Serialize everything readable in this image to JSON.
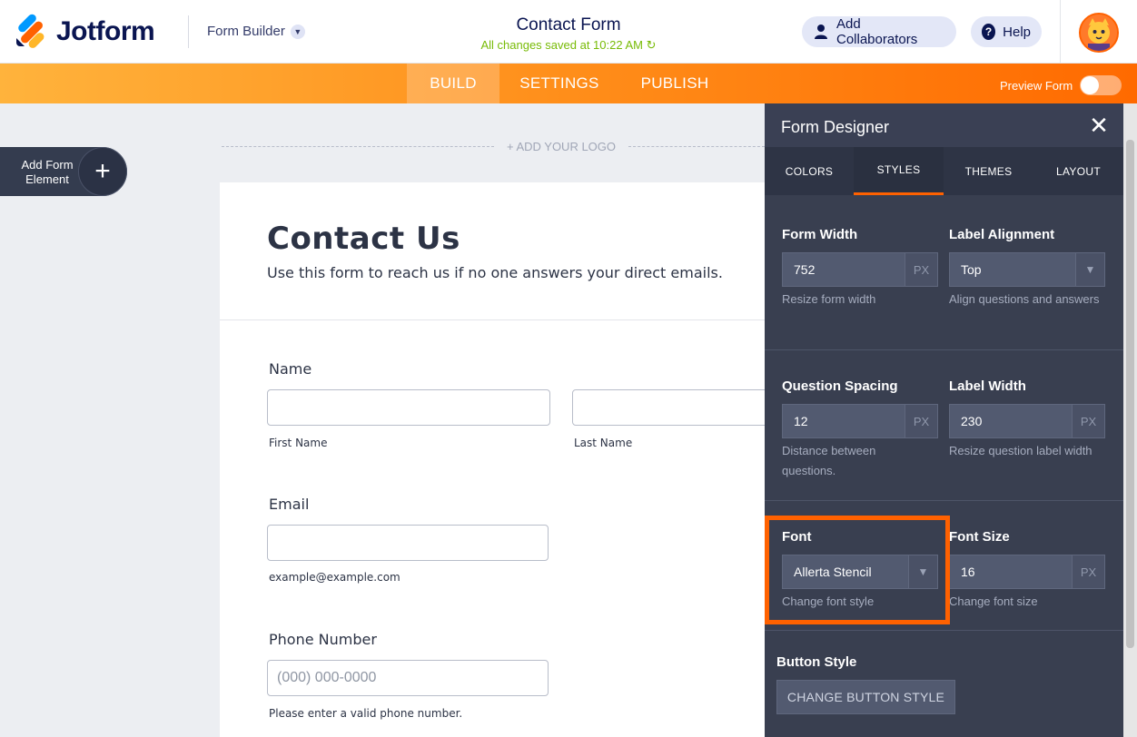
{
  "header": {
    "logo_text": "Jotform",
    "builder_label": "Form Builder",
    "form_title": "Contact Form",
    "save_status": "All changes saved at 10:22 AM",
    "collaborators_label": "Add Collaborators",
    "help_label": "Help"
  },
  "nav": {
    "tabs": [
      {
        "label": "BUILD",
        "active": true
      },
      {
        "label": "SETTINGS",
        "active": false
      },
      {
        "label": "PUBLISH",
        "active": false
      }
    ],
    "preview_label": "Preview Form",
    "preview_on": false
  },
  "add_element": {
    "label": "Add Form Element"
  },
  "logo_placeholder": "+ ADD YOUR LOGO",
  "form": {
    "title": "Contact Us",
    "subtitle": "Use this form to reach us if no one answers your direct emails.",
    "name_label": "Name",
    "first_name_sub": "First Name",
    "last_name_sub": "Last Name",
    "email_label": "Email",
    "email_sub": "example@example.com",
    "phone_label": "Phone Number",
    "phone_placeholder": "(000) 000-0000",
    "phone_sub": "Please enter a valid phone number."
  },
  "designer": {
    "title": "Form Designer",
    "tabs": [
      {
        "label": "COLORS",
        "active": false
      },
      {
        "label": "STYLES",
        "active": true
      },
      {
        "label": "THEMES",
        "active": false
      },
      {
        "label": "LAYOUT",
        "active": false
      }
    ],
    "form_width": {
      "label": "Form Width",
      "value": "752",
      "unit": "PX",
      "hint": "Resize form width"
    },
    "label_alignment": {
      "label": "Label Alignment",
      "value": "Top",
      "hint": "Align questions and answers"
    },
    "question_spacing": {
      "label": "Question Spacing",
      "value": "12",
      "unit": "PX",
      "hint": "Distance between questions."
    },
    "label_width": {
      "label": "Label Width",
      "value": "230",
      "unit": "PX",
      "hint": "Resize question label width"
    },
    "font": {
      "label": "Font",
      "value": "Allerta Stencil",
      "hint": "Change font style"
    },
    "font_size": {
      "label": "Font Size",
      "value": "16",
      "unit": "PX",
      "hint": "Change font size"
    },
    "button_style": {
      "label": "Button Style",
      "button": "CHANGE BUTTON STYLE"
    }
  },
  "colors": {
    "accent": "#ff6100",
    "panel": "#393f50",
    "navy": "#0a1551",
    "saved": "#78bb07"
  }
}
